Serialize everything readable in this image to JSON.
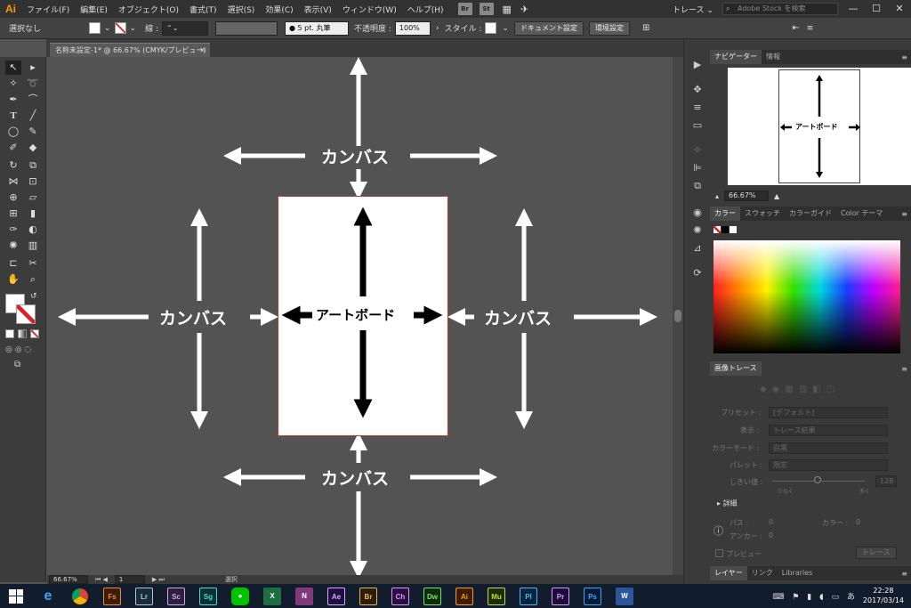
{
  "menubar": {
    "logo": "Ai",
    "items": [
      "ファイル(F)",
      "編集(E)",
      "オブジェクト(O)",
      "書式(T)",
      "選択(S)",
      "効果(C)",
      "表示(V)",
      "ウィンドウ(W)",
      "ヘルプ(H)"
    ],
    "bridge": "Br",
    "stock": "St",
    "workspace": "トレース ⌄",
    "search_placeholder": "Adobe Stock を検索",
    "window_controls": [
      "—",
      "☐",
      "✕"
    ]
  },
  "control": {
    "selection": "選択なし",
    "stroke_label": "線 :",
    "brush": "5 pt. 丸筆",
    "opacity_label": "不透明度 :",
    "opacity": "100%",
    "style_label": "スタイル :",
    "doc_setup": "ドキュメント設定",
    "prefs": "環境設定"
  },
  "doc_tab": {
    "title": "名称未設定-1* @ 66.67% (CMYK/プレビュー)",
    "close": "✕"
  },
  "canvas": {
    "label_canvas": "カンバス",
    "label_artboard": "アートボード",
    "background": "#535353",
    "artboard_border": "#c0392b"
  },
  "status": {
    "zoom": "66.67%",
    "page": "1",
    "mode": "選択"
  },
  "navigator": {
    "tabs": [
      "ナビゲーター",
      "情報"
    ],
    "zoom": "66.67%",
    "preview_label": "アートボード"
  },
  "color_panel": {
    "tabs": [
      "カラー",
      "スウォッチ",
      "カラーガイド",
      "Color テーマ"
    ]
  },
  "trace_panel": {
    "title": "画像トレース",
    "rows": [
      {
        "label": "プリセット :",
        "value": "[デフォルト]"
      },
      {
        "label": "表示 :",
        "value": "トレース結果"
      },
      {
        "label": "カラーモード :",
        "value": "白黒"
      },
      {
        "label": "パレット :",
        "value": "限定"
      }
    ],
    "threshold_label": "しきい値 :",
    "threshold_value": "128",
    "low": "少なく",
    "high": "多く",
    "details": "詳細",
    "paths_label": "パス :",
    "paths": "0",
    "colors_label": "カラー :",
    "colors": "0",
    "anchors_label": "アンカー :",
    "anchors": "0",
    "preview": "プレビュー",
    "trace_button": "トレース"
  },
  "layers_panel": {
    "tabs": [
      "レイヤー",
      "リンク",
      "Libraries"
    ]
  },
  "taskbar": {
    "apps": [
      {
        "id": "Fs",
        "bg": "#3a1d07",
        "fg": "#f08a24"
      },
      {
        "id": "Lr",
        "bg": "#1c2b38",
        "fg": "#9fc9e8"
      },
      {
        "id": "Sc",
        "bg": "#2e1f3d",
        "fg": "#c7a9e8"
      },
      {
        "id": "Sg",
        "bg": "#0b3030",
        "fg": "#4fd8d8"
      },
      {
        "id": "Ae",
        "bg": "#1f0f40",
        "fg": "#d7a6ff"
      },
      {
        "id": "Br",
        "bg": "#2c1d09",
        "fg": "#e8b454"
      },
      {
        "id": "Ch",
        "bg": "#2a0f3f",
        "fg": "#d69af5"
      },
      {
        "id": "Dw",
        "bg": "#0f2b0c",
        "fg": "#7fe06c"
      },
      {
        "id": "Ai",
        "bg": "#3a1d04",
        "fg": "#ff9a00"
      },
      {
        "id": "Mu",
        "bg": "#1d2b08",
        "fg": "#b8e04c"
      },
      {
        "id": "Pl",
        "bg": "#07243a",
        "fg": "#4fb7ff"
      },
      {
        "id": "Pr",
        "bg": "#1e0c38",
        "fg": "#d29bff"
      },
      {
        "id": "Ps",
        "bg": "#071c34",
        "fg": "#31a8ff"
      }
    ],
    "time": "22:28",
    "date": "2017/03/14",
    "ime": "あ"
  }
}
